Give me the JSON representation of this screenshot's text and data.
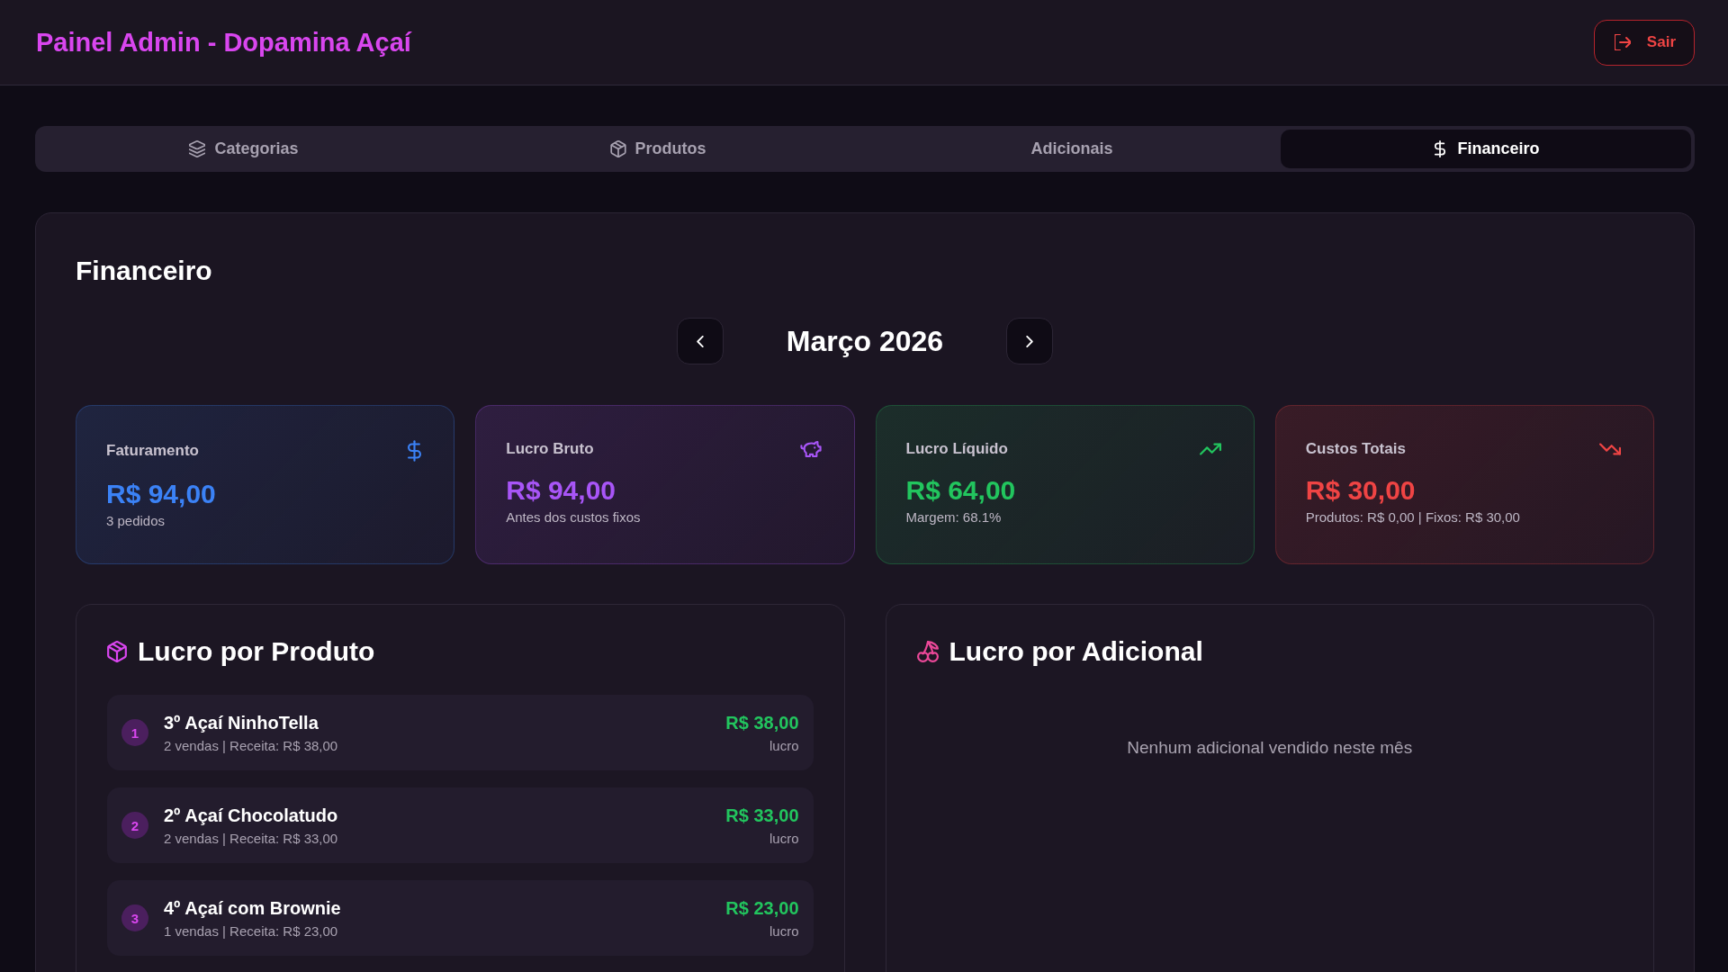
{
  "header": {
    "title": "Painel Admin - Dopamina Açaí",
    "logout_button": "Sair"
  },
  "tabs": [
    {
      "label": "Categorias",
      "selected": false
    },
    {
      "label": "Produtos",
      "selected": false
    },
    {
      "label": "Adicionais",
      "selected": false
    },
    {
      "label": "Financeiro",
      "selected": true
    }
  ],
  "finance": {
    "title": "Financeiro",
    "month": "Março 2026",
    "cards": [
      {
        "label": "Faturamento",
        "value": "R$ 94,00",
        "note": "3 pedidos",
        "color": "#3b82f6"
      },
      {
        "label": "Lucro Bruto",
        "value": "R$ 94,00",
        "note": "Antes dos custos fixos",
        "color": "#a855f7"
      },
      {
        "label": "Lucro Líquido",
        "value": "R$ 64,00",
        "note": "Margem: 68.1%",
        "color": "#22c55e"
      },
      {
        "label": "Custos Totais",
        "value": "R$ 30,00",
        "note": "Produtos: R$ 0,00 | Fixos: R$ 30,00",
        "color": "#ef4444"
      }
    ],
    "product_profit": {
      "title": "Lucro por Produto",
      "items": [
        {
          "rank": "1",
          "name": "3º Açaí NinhoTella",
          "detail": "2 vendas | Receita: R$ 38,00",
          "profit": "R$ 38,00",
          "profit_label": "lucro"
        },
        {
          "rank": "2",
          "name": "2º Açaí Chocolatudo",
          "detail": "2 vendas | Receita: R$ 33,00",
          "profit": "R$ 33,00",
          "profit_label": "lucro"
        },
        {
          "rank": "3",
          "name": "4º Açaí com Brownie",
          "detail": "1 vendas | Receita: R$ 23,00",
          "profit": "R$ 23,00",
          "profit_label": "lucro"
        }
      ]
    },
    "addon_profit": {
      "title": "Lucro por Adicional",
      "empty_message": "Nenhum adicional vendido neste mês"
    }
  }
}
